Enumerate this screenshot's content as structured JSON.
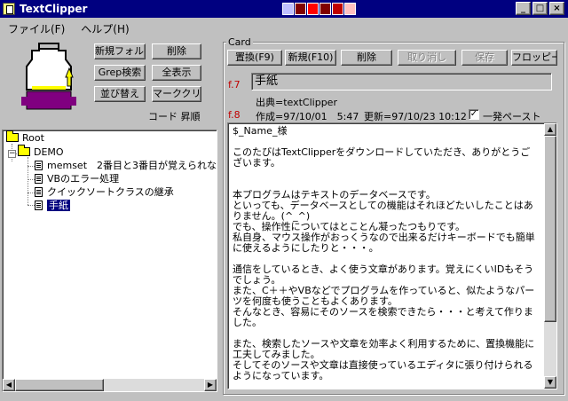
{
  "window": {
    "title": "TextClipper",
    "minimize": "_",
    "maximize": "□",
    "close": "×"
  },
  "menu": [
    "ファイル(F)",
    "ヘルプ(H)"
  ],
  "left_panel": {
    "buttons": {
      "new_folder": "新規フォルダ",
      "delete": "削除",
      "grep": "Grep検索",
      "show_all": "全表示",
      "sort": "並び替え",
      "mark_clear": "マーククリア"
    },
    "sort_label": "コード 昇順"
  },
  "tree": {
    "root": "Root",
    "demo": "DEMO",
    "items": [
      "memset　2番目と3番目が覚えられな",
      "VBのエラー処理",
      "クイックソートクラスの継承",
      "手紙"
    ]
  },
  "card": {
    "caption": "Card",
    "buttons": {
      "replace": "置換(F9)",
      "new": "新規(F10)",
      "delete": "削除",
      "undo": "取り消し",
      "save": "保存",
      "floppy": "フロッピー"
    },
    "f7": "f.7",
    "f8": "f.8",
    "title": "手紙",
    "source": "出典=textClipper",
    "created": "作成=97/10/01　5:47",
    "updated": "更新=97/10/23 10:12",
    "paste_check": "✓",
    "paste_label": "一発ペースト",
    "body": "$_Name_様\n\nこのたびはTextClipperをダウンロードしていただき、ありがとうございます。\n\n\n本プログラムはテキストのデータベースです。\nといっても、データベースとしての機能はそれほどたいしたことはありません。(^_^)\nでも、操作性についてはとことん凝ったつもりです。\n私自身、マウス操作がおっくうなので出来るだけキーボードでも簡単に使えるようにしたりと・・・。\n\n通信をしているとき、よく使う文章があります。覚えにくいIDもそうでしょう。\nまた、C＋＋やVBなどでプログラムを作っていると、似たようなパーツを何度も使うこともよくあります。\nそんなとき、容易にそのソースを検索できたら・・・と考えて作りました。\n\nまた、検索したソースや文章を効率よく利用するために、置換機能に工夫してみました。\nそしてそのソースや文章は直接使っているエディタに張り付けられるようになっています。"
  },
  "colors": {
    "titlebar": "#000080",
    "face": "#c0c0c0",
    "fkey": "#c00000",
    "logo_purple": "#800080",
    "logo_yellow": "#ffff00"
  }
}
